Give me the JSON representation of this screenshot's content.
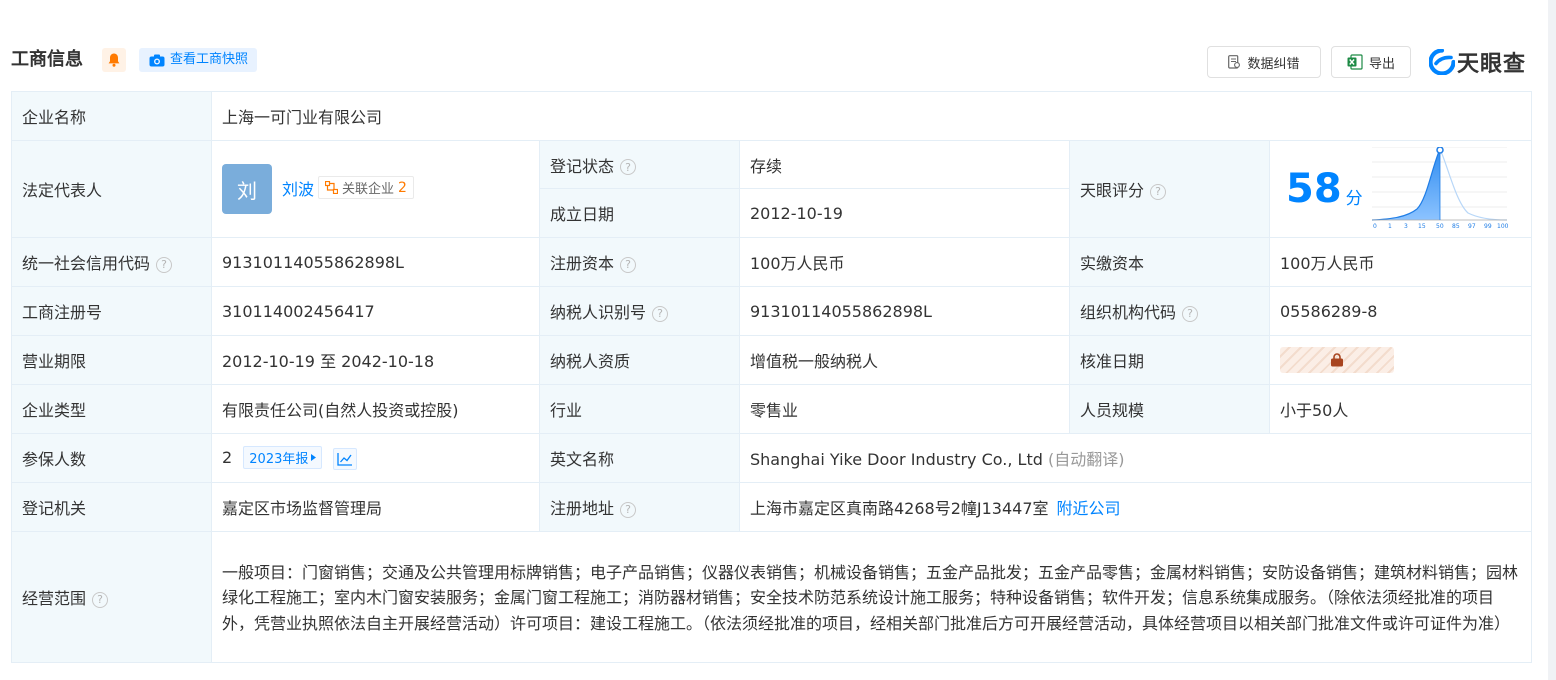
{
  "header": {
    "title": "工商信息",
    "snapshot_label": "查看工商快照",
    "correct_label": "数据纠错",
    "export_label": "导出",
    "logo_text": "天眼查",
    "accent_color": "#0084ff"
  },
  "company": {
    "name_label": "企业名称",
    "name": "上海一可门业有限公司",
    "legal_label": "法定代表人",
    "legal_avatar_char": "刘",
    "legal_name": "刘波",
    "related_label": "关联企业",
    "related_count": "2",
    "status_label": "登记状态",
    "status": "存续",
    "founded_label": "成立日期",
    "founded": "2012-10-19",
    "score_label": "天眼评分",
    "score": "58",
    "score_unit": "分",
    "score_axis": [
      "0",
      "1",
      "3",
      "15",
      "50",
      "85",
      "97",
      "99",
      "100"
    ],
    "credit_code_label": "统一社会信用代码",
    "credit_code": "91310114055862898L",
    "reg_capital_label": "注册资本",
    "reg_capital": "100万人民币",
    "paid_capital_label": "实缴资本",
    "paid_capital": "100万人民币",
    "reg_no_label": "工商注册号",
    "reg_no": "310114002456417",
    "taxpayer_id_label": "纳税人识别号",
    "taxpayer_id": "91310114055862898L",
    "org_code_label": "组织机构代码",
    "org_code": "05586289-8",
    "term_label": "营业期限",
    "term": "2012-10-19 至 2042-10-18",
    "tax_qual_label": "纳税人资质",
    "tax_qual": "增值税一般纳税人",
    "approve_label": "核准日期",
    "type_label": "企业类型",
    "type": "有限责任公司(自然人投资或控股)",
    "industry_label": "行业",
    "industry": "零售业",
    "staff_label": "人员规模",
    "staff": "小于50人",
    "insured_label": "参保人数",
    "insured": "2",
    "report_label": "2023年报",
    "en_name_label": "英文名称",
    "en_name": "Shanghai Yike Door Industry Co., Ltd",
    "en_name_note": "(自动翻译)",
    "authority_label": "登记机关",
    "authority": "嘉定区市场监督管理局",
    "address_label": "注册地址",
    "address": "上海市嘉定区真南路4268号2幢J13447室",
    "nearby_label": "附近公司",
    "scope_label": "经营范围",
    "scope": "一般项目：门窗销售；交通及公共管理用标牌销售；电子产品销售；仪器仪表销售；机械设备销售；五金产品批发；五金产品零售；金属材料销售；安防设备销售；建筑材料销售；园林绿化工程施工；室内木门窗安装服务；金属门窗工程施工；消防器材销售；安全技术防范系统设计施工服务；特种设备销售；软件开发；信息系统集成服务。（除依法须经批准的项目外，凭营业执照依法自主开展经营活动）许可项目：建设工程施工。（依法须经批准的项目，经相关部门批准后方可开展经营活动，具体经营项目以相关部门批准文件或许可证件为准）"
  }
}
